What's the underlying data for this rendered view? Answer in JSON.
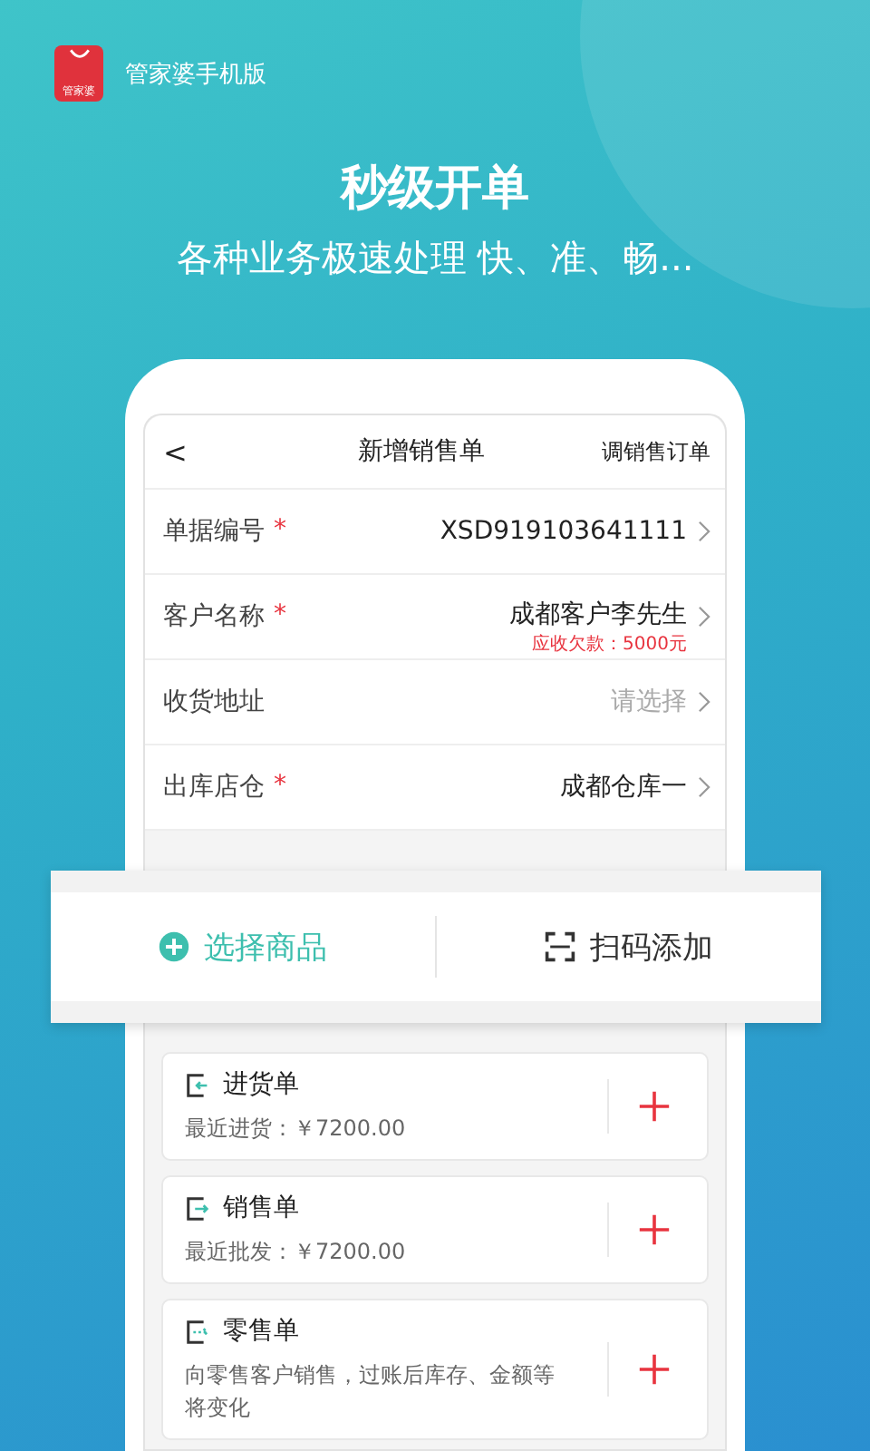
{
  "brand": {
    "logo_text": "管家婆",
    "name": "管家婆手机版"
  },
  "headline": "秒级开单",
  "subheadline": "各种业务极速处理 快、准、畅...",
  "screen": {
    "back": "<",
    "title": "新增销售单",
    "action": "调销售订单",
    "fields": [
      {
        "label": "单据编号",
        "required_mark": "*",
        "value": "XSD919103641111"
      },
      {
        "label": "客户名称",
        "required_mark": "*",
        "value": "成都客户李先生",
        "note": "应收欠款：5000元"
      },
      {
        "label": "收货地址",
        "placeholder": "请选择"
      },
      {
        "label": "出库店仓",
        "required_mark": "*",
        "value": "成都仓库一"
      }
    ]
  },
  "actions": [
    {
      "kind": "add",
      "label": "选择商品"
    },
    {
      "kind": "scan",
      "label": "扫码添加"
    }
  ],
  "cards": [
    {
      "title": "进货单",
      "subtitle": "最近进货：￥7200.00",
      "kind": "in"
    },
    {
      "title": "销售单",
      "subtitle": "最近批发：￥7200.00",
      "kind": "out"
    },
    {
      "title": "零售单",
      "subtitle": "向零售客户销售，过账后库存、金额等将变化",
      "kind": "dotted"
    }
  ]
}
